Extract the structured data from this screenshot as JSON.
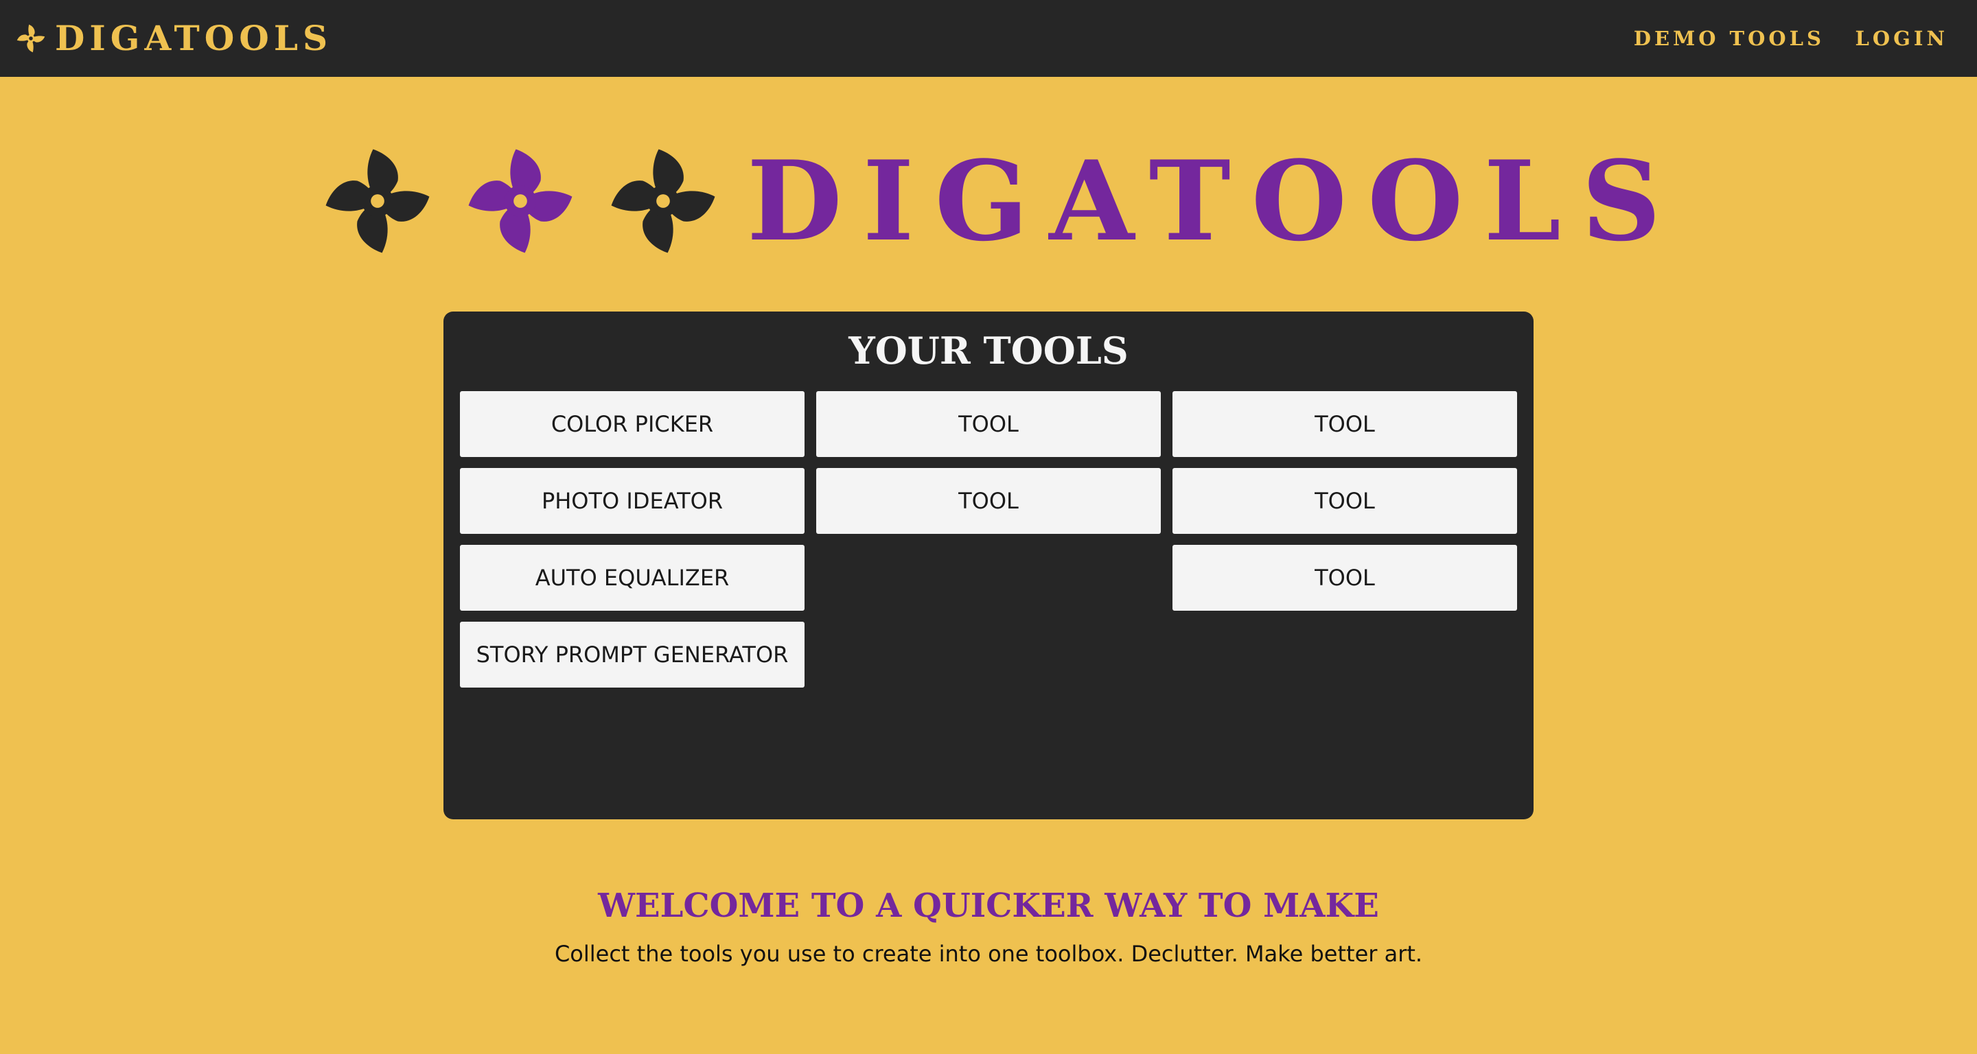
{
  "nav": {
    "brand": "DIGATOOLS",
    "links": [
      "DEMO TOOLS",
      "LOGIN"
    ]
  },
  "hero": {
    "title": "DIGATOOLS",
    "pinwheel_icons": [
      "pinwheel-icon",
      "pinwheel-icon",
      "pinwheel-icon"
    ],
    "pinwheel_colors": [
      "#262626",
      "#74279d",
      "#262626"
    ]
  },
  "tools": {
    "title": "YOUR TOOLS",
    "column1": [
      "COLOR PICKER",
      "PHOTO IDEATOR",
      "AUTO EQUALIZER",
      "STORY PROMPT GENERATOR"
    ],
    "column2": [
      "TOOL",
      "TOOL"
    ],
    "column3": [
      "TOOL",
      "TOOL",
      "TOOL"
    ]
  },
  "welcome": {
    "heading": "WELCOME TO A QUICKER WAY TO MAKE",
    "text": "Collect the tools you use to create into one toolbox. Declutter. Make better art."
  },
  "colors": {
    "background": "#efc150",
    "dark": "#262626",
    "accent": "#74279d",
    "button": "#f4f4f4"
  }
}
